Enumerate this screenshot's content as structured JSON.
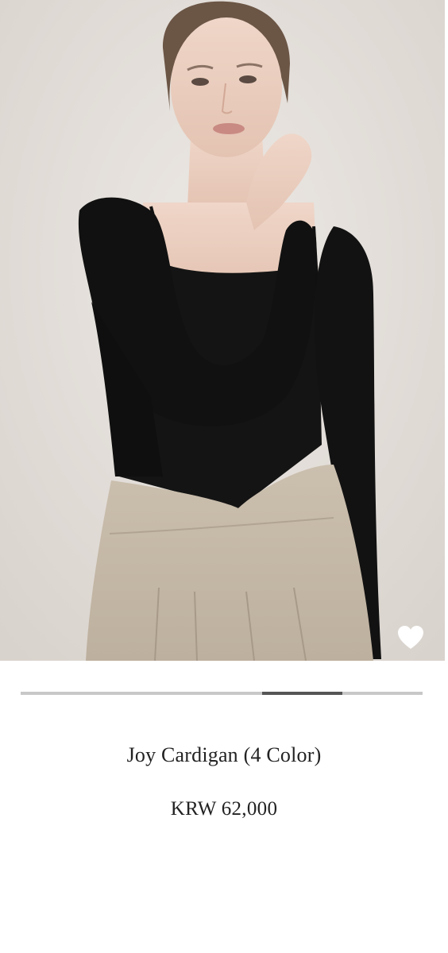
{
  "product": {
    "image_alt_subject": "model-wearing-black-cardigan-and-beige-skirt",
    "name": "Joy Cardigan (4 Color)",
    "price": "KRW 62,000",
    "wishlist_icon": "heart-icon"
  },
  "image_slider": {
    "progress_start_fraction": 0.6,
    "progress_end_fraction": 0.8
  },
  "colors": {
    "background": "#ffffff",
    "photo_background": "#e7e2dd",
    "slider_track": "#c8c8c8",
    "slider_thumb": "#555555",
    "text": "#222222",
    "heart": "#ffffff"
  }
}
